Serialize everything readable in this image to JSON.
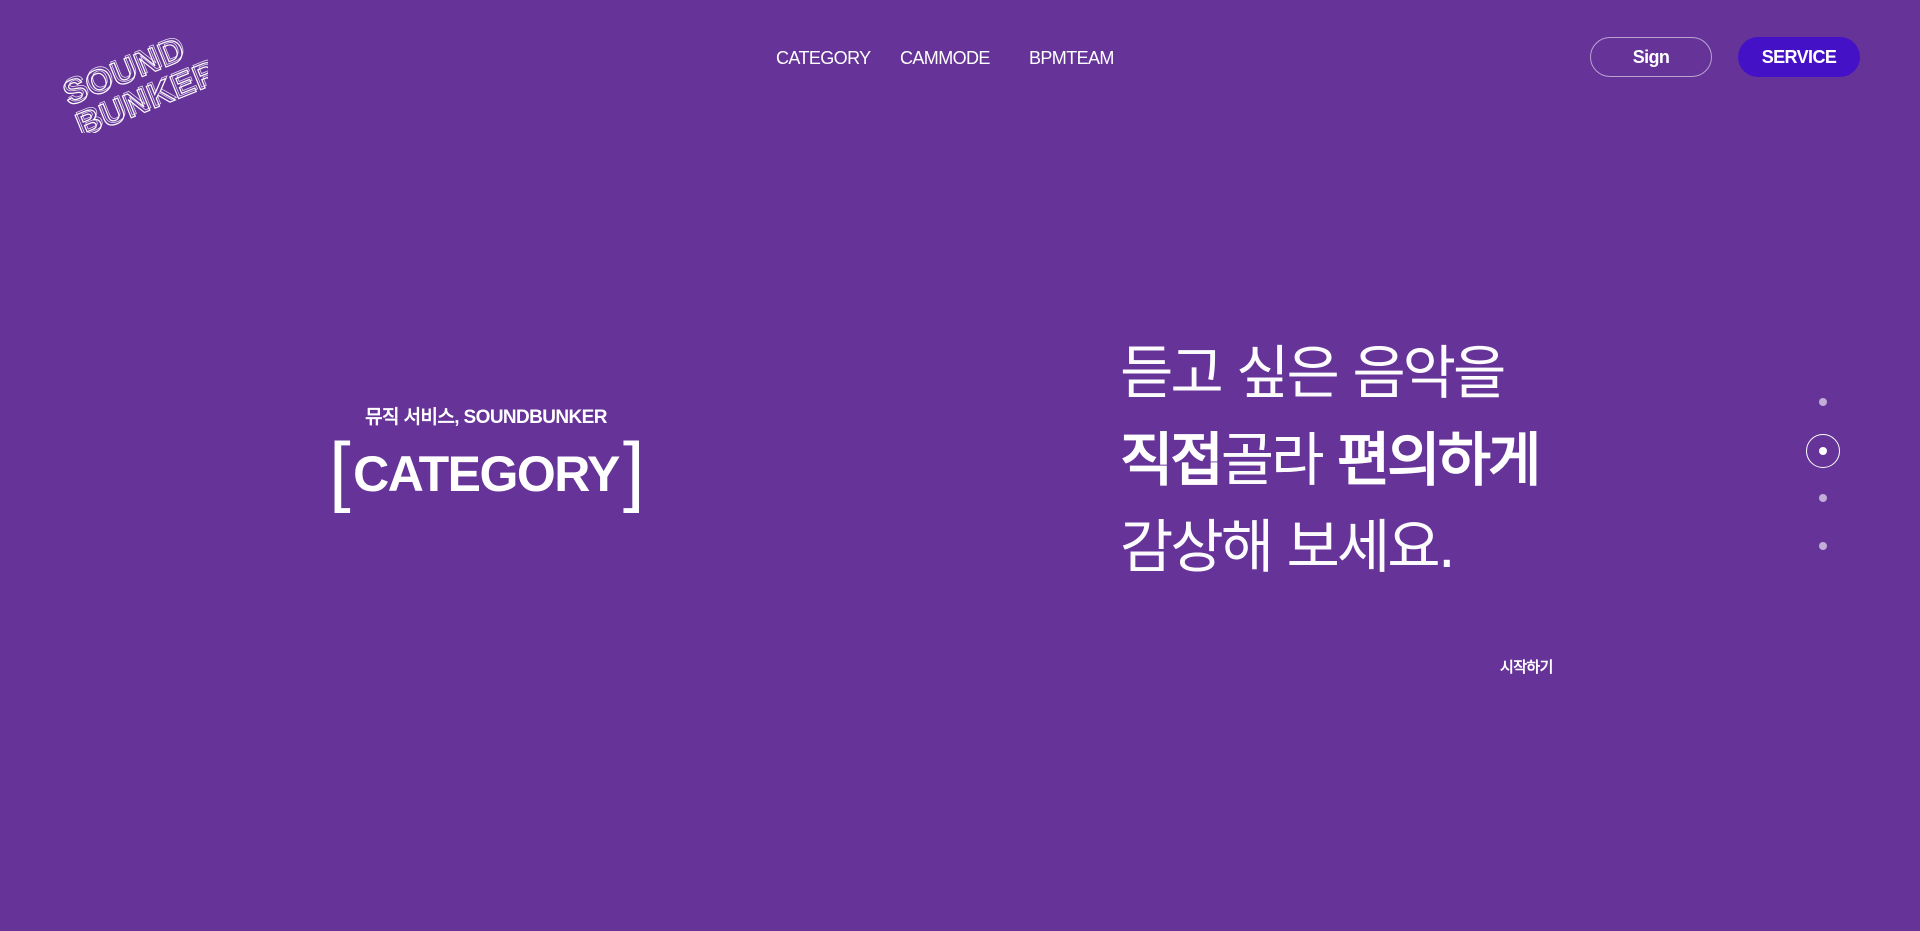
{
  "brand": {
    "logo_line1": "SOUND",
    "logo_line2": "BUNKER"
  },
  "nav": {
    "items": [
      {
        "label": "CATEGORY"
      },
      {
        "label": "CAMMODE"
      },
      {
        "label": "BPMTEAM"
      }
    ]
  },
  "header": {
    "sign_label": "Sign",
    "service_label": "SERVICE"
  },
  "hero": {
    "subtitle": "뮤직 서비스, SOUNDBUNKER",
    "bracket_open": "[",
    "title": "CATEGORY",
    "bracket_close": "]",
    "headline_line1": "듣고 싶은 음악을",
    "headline_line2_bold1": "직접",
    "headline_line2_mid": "골라 ",
    "headline_line2_bold2": "편의하게",
    "headline_line3": "감상해 보세요.",
    "cta_label": "시작하기"
  },
  "pagination": {
    "total": 4,
    "active_index": 2
  },
  "colors": {
    "background": "#663399",
    "service_button": "#4511c6",
    "text": "#ffffff"
  }
}
